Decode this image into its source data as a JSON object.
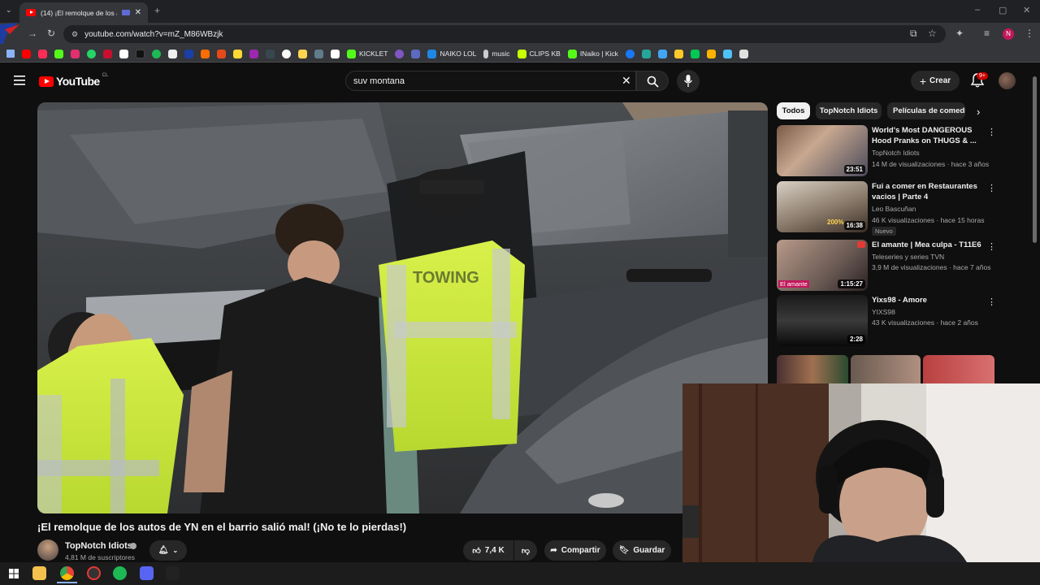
{
  "browser": {
    "tab_title": "(14) ¡El remolque de los auto",
    "url": "youtube.com/watch?v=mZ_M86WBzjk",
    "bookmarks": [
      {
        "label": "KICKLET"
      },
      {
        "label": "NAIKO LOL"
      },
      {
        "label": "music"
      },
      {
        "label": "CLIPS KB"
      },
      {
        "label": "INaiko | Kick"
      }
    ]
  },
  "youtube": {
    "logo_text": "YouTube",
    "country": "CL",
    "search_query": "suv montana",
    "create_label": "Crear",
    "notifications": "9+"
  },
  "video": {
    "title": "¡El remolque de los autos de YN en el barrio salió mal! (¡No te lo pierdas!)",
    "channel": "TopNotch Idiots",
    "subscribers": "4,81 M de suscriptores",
    "likes": "7,4 K",
    "share_label": "Compartir",
    "save_label": "Guardar",
    "vest_text": "TOWING"
  },
  "chips": [
    "Todos",
    "TopNotch Idiots",
    "Películas de comedia"
  ],
  "recommendations": [
    {
      "title": "World's Most DANGEROUS Hood Pranks on THUGS & ...",
      "channel": "TopNotch Idiots",
      "meta": "14 M de visualizaciones · hace 3 años",
      "duration": "23:51"
    },
    {
      "title": "Fui a comer en Restaurantes vacios | Parte 4",
      "channel": "Leo Bascuñan",
      "meta": "46 K visualizaciones · hace 15 horas",
      "duration": "16:38",
      "badge": "Nuevo",
      "thumb_tag": "200%"
    },
    {
      "title": "El amante | Mea culpa - T11E6",
      "channel": "Teleseries y series TVN",
      "meta": "3,9 M de visualizaciones · hace 7 años",
      "duration": "1:15:27",
      "thumb_tag": "El amante"
    },
    {
      "title": "Yixs98 - Amore",
      "channel": "YIXS98",
      "meta": "43 K visualizaciones · hace 2 años",
      "duration": "2:28"
    }
  ]
}
